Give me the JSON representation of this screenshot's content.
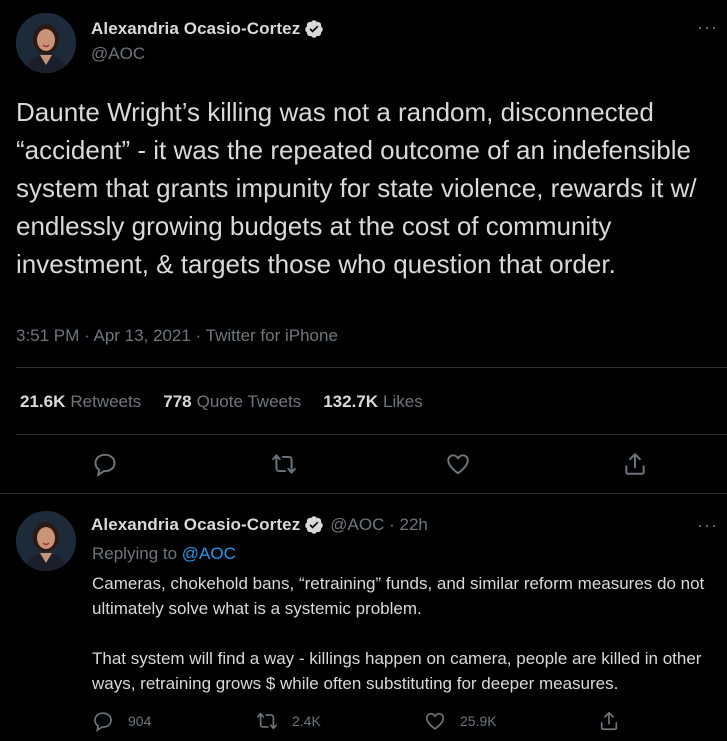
{
  "main_tweet": {
    "display_name": "Alexandria Ocasio-Cortez",
    "handle": "@AOC",
    "more": "···",
    "text": "Daunte Wright’s killing was not a random, disconnected “accident” - it was the repeated outcome of an indefensible system that grants impunity for state violence, rewards it w/ endlessly growing budgets at the cost of community investment, & targets those who question that order.",
    "meta": "3:51 PM · Apr 13, 2021 · Twitter for iPhone",
    "stats": {
      "retweets_count": "21.6K",
      "retweets_label": "Retweets",
      "quotes_count": "778",
      "quotes_label": "Quote Tweets",
      "likes_count": "132.7K",
      "likes_label": "Likes"
    },
    "actions": [
      "reply-icon",
      "retweet-icon",
      "like-icon",
      "share-icon"
    ]
  },
  "reply_tweet": {
    "display_name": "Alexandria Ocasio-Cortez",
    "handle_time": "@AOC · 22h",
    "more": "···",
    "replying_prefix": "Replying to",
    "replying_handle": "@AOC",
    "text": "Cameras, chokehold bans, “retraining” funds, and similar reform measures do not ultimately solve what is a systemic problem.\n\nThat system will find a way - killings happen on camera, people are killed in other ways, retraining grows $ while often substituting for deeper measures.",
    "reply_count": "904",
    "retweet_count": "2.4K",
    "like_count": "25.9K"
  },
  "colors": {
    "background": "#000000",
    "text": "#d9d9d9",
    "muted": "#6e767d",
    "link": "#1d9bf0",
    "border": "#2f3336"
  }
}
